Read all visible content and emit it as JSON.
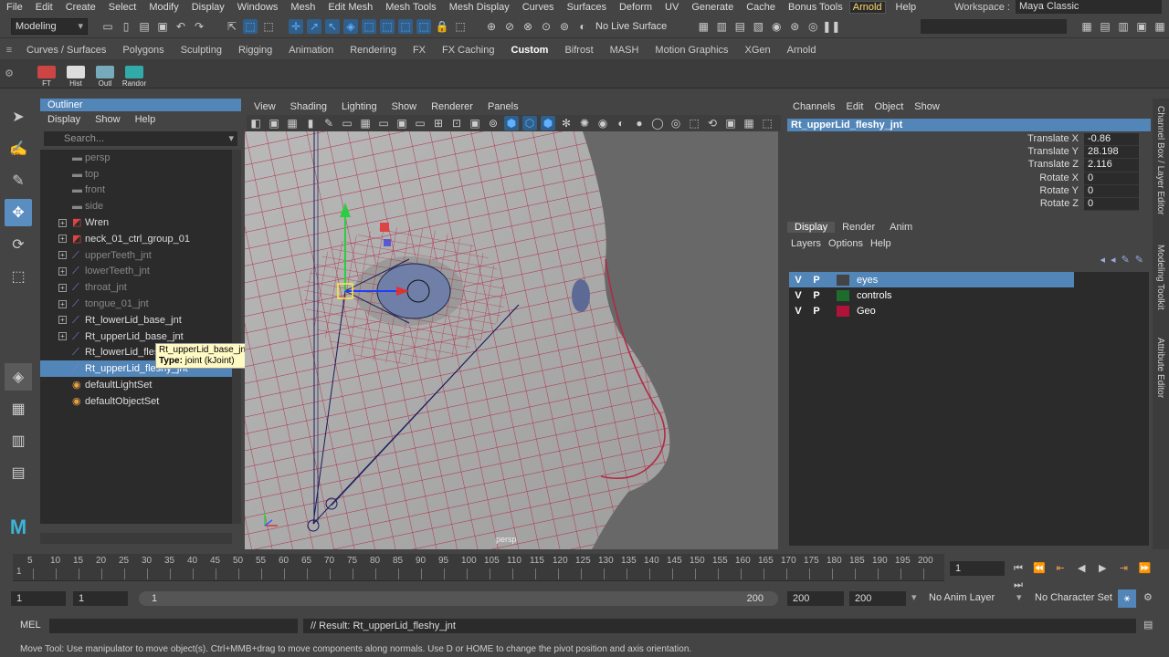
{
  "menubar": {
    "items": [
      "File",
      "Edit",
      "Create",
      "Select",
      "Modify",
      "Display",
      "Windows",
      "Mesh",
      "Edit Mesh",
      "Mesh Tools",
      "Mesh Display",
      "Curves",
      "Surfaces",
      "Deform",
      "UV",
      "Generate",
      "Cache",
      "Bonus Tools"
    ],
    "arnold": "Arnold",
    "help": "Help",
    "workspace_label": "Workspace :",
    "workspace_value": "Maya Classic"
  },
  "statusline": {
    "mode": "Modeling",
    "live_surface": "No Live Surface"
  },
  "shelf": {
    "tabs": [
      "Curves / Surfaces",
      "Polygons",
      "Sculpting",
      "Rigging",
      "Animation",
      "Rendering",
      "FX",
      "FX Caching",
      "Custom",
      "Bifrost",
      "MASH",
      "Motion Graphics",
      "XGen",
      "Arnold"
    ],
    "active_tab": "Custom",
    "buttons": [
      {
        "label": "FT",
        "color": "#c44"
      },
      {
        "label": "Hist",
        "color": "#ddd"
      },
      {
        "label": "Outl",
        "color": "#7ab"
      },
      {
        "label": "Randor",
        "color": "#3aa"
      }
    ]
  },
  "outliner": {
    "title": "Outliner",
    "menus": [
      "Display",
      "Show",
      "Help"
    ],
    "search_placeholder": "Search...",
    "items": [
      {
        "label": "persp",
        "dim": true,
        "exp": false,
        "icon": "camera"
      },
      {
        "label": "top",
        "dim": true,
        "exp": false,
        "icon": "camera"
      },
      {
        "label": "front",
        "dim": true,
        "exp": false,
        "icon": "camera"
      },
      {
        "label": "side",
        "dim": true,
        "exp": false,
        "icon": "camera"
      },
      {
        "label": "Wren",
        "dim": false,
        "exp": true,
        "icon": "mesh"
      },
      {
        "label": "neck_01_ctrl_group_01",
        "dim": false,
        "exp": true,
        "icon": "mesh"
      },
      {
        "label": "upperTeeth_jnt",
        "dim": true,
        "exp": true,
        "icon": "joint"
      },
      {
        "label": "lowerTeeth_jnt",
        "dim": true,
        "exp": true,
        "icon": "joint"
      },
      {
        "label": "throat_jnt",
        "dim": true,
        "exp": true,
        "icon": "joint"
      },
      {
        "label": "tongue_01_jnt",
        "dim": true,
        "exp": true,
        "icon": "joint"
      },
      {
        "label": "Rt_lowerLid_base_jnt",
        "dim": false,
        "exp": true,
        "icon": "joint"
      },
      {
        "label": "Rt_upperLid_base_jnt",
        "dim": false,
        "exp": true,
        "icon": "joint"
      },
      {
        "label": "Rt_lowerLid_fleshy_jnt",
        "dim": false,
        "exp": false,
        "icon": "joint"
      },
      {
        "label": "Rt_upperLid_fleshy_jnt",
        "dim": false,
        "exp": false,
        "icon": "joint",
        "selected": true
      },
      {
        "label": "defaultLightSet",
        "dim": false,
        "exp": false,
        "icon": "set"
      },
      {
        "label": "defaultObjectSet",
        "dim": false,
        "exp": false,
        "icon": "set"
      }
    ],
    "tooltip_name": "Rt_upperLid_base_jnt",
    "tooltip_type_label": "Type:",
    "tooltip_type": "joint (kJoint)"
  },
  "viewport": {
    "menus": [
      "View",
      "Shading",
      "Lighting",
      "Show",
      "Renderer",
      "Panels"
    ],
    "camera_label": "persp"
  },
  "channels": {
    "menus": [
      "Channels",
      "Edit",
      "Object",
      "Show"
    ],
    "object": "Rt_upperLid_fleshy_jnt",
    "attrs": [
      {
        "name": "Translate X",
        "value": "-0.86"
      },
      {
        "name": "Translate Y",
        "value": "28.198"
      },
      {
        "name": "Translate Z",
        "value": "2.116"
      },
      {
        "name": "Rotate X",
        "value": "0"
      },
      {
        "name": "Rotate Y",
        "value": "0"
      },
      {
        "name": "Rotate Z",
        "value": "0"
      }
    ]
  },
  "layers": {
    "tabs": [
      "Display",
      "Render",
      "Anim"
    ],
    "menus": [
      "Layers",
      "Options",
      "Help"
    ],
    "rows": [
      {
        "v": "V",
        "p": "P",
        "name": "eyes",
        "color": "#444",
        "selected": true
      },
      {
        "v": "V",
        "p": "P",
        "name": "controls",
        "color": "#1e6b2e",
        "selected": false
      },
      {
        "v": "V",
        "p": "P",
        "name": "Geo",
        "color": "#b0123a",
        "selected": false
      }
    ]
  },
  "sidetabs": [
    "Channel Box / Layer Editor",
    "Modeling Toolkit",
    "Attribute Editor"
  ],
  "timeline": {
    "ticks": [
      "5",
      "10",
      "15",
      "20",
      "25",
      "30",
      "35",
      "40",
      "45",
      "50",
      "55",
      "60",
      "65",
      "70",
      "75",
      "80",
      "85",
      "90",
      "95",
      "100",
      "105",
      "110",
      "115",
      "120",
      "125",
      "130",
      "135",
      "140",
      "145",
      "150",
      "155",
      "160",
      "165",
      "170",
      "175",
      "180",
      "185",
      "190",
      "195",
      "200"
    ],
    "start_tick": "1",
    "current_frame": "1"
  },
  "range": {
    "start": "1",
    "anim_start": "1",
    "slider_lo": "1",
    "slider_hi": "200",
    "anim_end": "200",
    "end": "200",
    "anim_layer": "No Anim Layer",
    "character_set": "No Character Set"
  },
  "cmdline": {
    "label": "MEL",
    "result": "// Result: Rt_upperLid_fleshy_jnt"
  },
  "helpline": "Move Tool: Use manipulator to move object(s). Ctrl+MMB+drag to move components along normals. Use D or HOME to change the pivot position and axis orientation."
}
